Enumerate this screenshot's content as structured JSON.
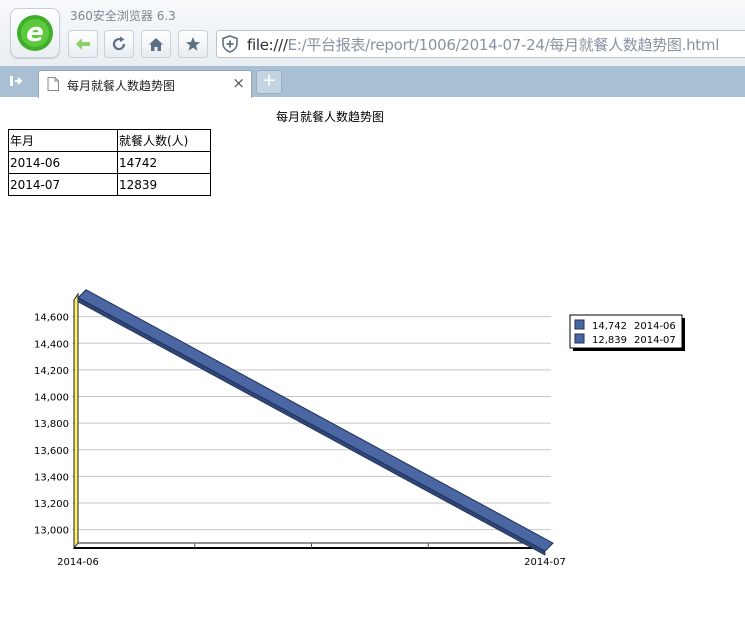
{
  "browser": {
    "app_title": "360安全浏览器 6.3",
    "address_prefix": "file:///",
    "address_path": "E:/平台报表/report/1006/2014-07-24/每月就餐人数趋势图.html",
    "tab_label": "每月就餐人数趋势图",
    "tab_close": "×",
    "new_tab": "+"
  },
  "page": {
    "title": "每月就餐人数趋势图",
    "table": {
      "headers": [
        "年月",
        "就餐人数(人)"
      ],
      "rows": [
        [
          "2014-06",
          "14742"
        ],
        [
          "2014-07",
          "12839"
        ]
      ]
    }
  },
  "chart_data": {
    "type": "line",
    "categories": [
      "2014-06",
      "2014-07"
    ],
    "series": [
      {
        "values": [
          14742,
          12839
        ],
        "color": "#4a67a3"
      }
    ],
    "ylim": [
      12900,
      14740
    ],
    "yticks": [
      13000,
      13200,
      13400,
      13600,
      13800,
      14000,
      14200,
      14400,
      14600
    ],
    "ytick_labels": [
      "13,000",
      "13,200",
      "13,400",
      "13,600",
      "13,800",
      "14,000",
      "14,200",
      "14,400",
      "14,600"
    ],
    "legend": [
      {
        "value": "14,742",
        "label": "2014-06"
      },
      {
        "value": "12,839",
        "label": "2014-07"
      }
    ],
    "legend_position": "right",
    "grid": true,
    "wall_color": "#fff06a"
  }
}
